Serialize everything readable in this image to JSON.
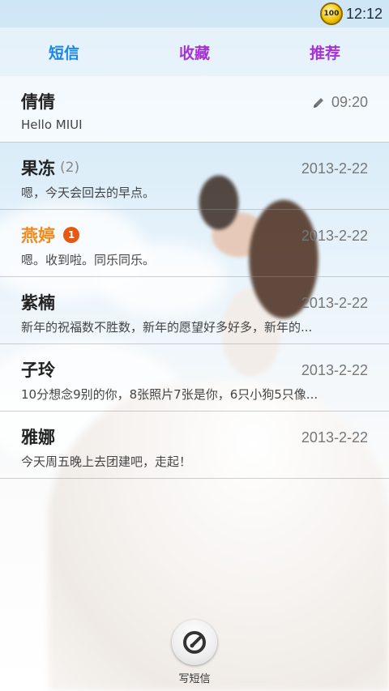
{
  "status_bar": {
    "battery_level": "100",
    "time": "12:12"
  },
  "tabs": [
    {
      "label": "短信",
      "color": "#1b86e6"
    },
    {
      "label": "收藏",
      "color": "#a633d6"
    },
    {
      "label": "推荐",
      "color": "#a633d6"
    }
  ],
  "conversations": [
    {
      "name": "倩倩",
      "count": "",
      "unread": "",
      "preview": "Hello MIUI",
      "time": "09:20",
      "draft": true
    },
    {
      "name": "果冻",
      "count": "(2)",
      "unread": "",
      "preview": "嗯，今天会回去的早点。",
      "time": "2013-2-22",
      "draft": false
    },
    {
      "name": "燕婷",
      "count": "",
      "unread": "1",
      "preview": "嗯。收到啦。同乐同乐。",
      "time": "2013-2-22",
      "draft": false
    },
    {
      "name": "紫楠",
      "count": "",
      "unread": "",
      "preview": "新年的祝福数不胜数，新年的愿望好多好多，新年的...",
      "time": "2013-2-22",
      "draft": false
    },
    {
      "name": "子玲",
      "count": "",
      "unread": "",
      "preview": "10分想念9别的你，8张照片7张是你，6只小狗5只像...",
      "time": "2013-2-22",
      "draft": false
    },
    {
      "name": "雅娜",
      "count": "",
      "unread": "",
      "preview": "今天周五晚上去团建吧，走起！",
      "time": "2013-2-22",
      "draft": false
    }
  ],
  "compose": {
    "label": "写短信",
    "icon": "compose-icon"
  },
  "colors": {
    "unread_name": "#f08a1c",
    "unread_badge": "#e45a14"
  }
}
